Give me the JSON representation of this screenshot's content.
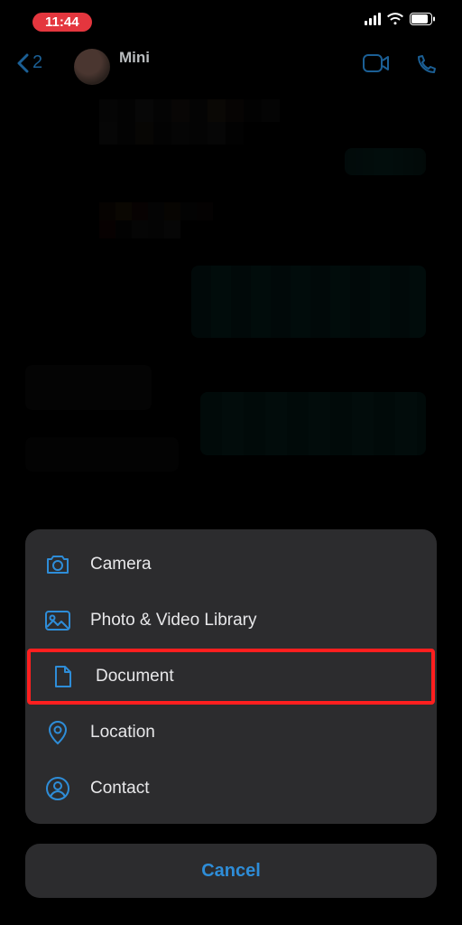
{
  "status": {
    "time": "11:44"
  },
  "nav": {
    "back_count": "2",
    "chat_name": "Mini"
  },
  "sheet": {
    "items": [
      {
        "name": "camera",
        "label": "Camera"
      },
      {
        "name": "library",
        "label": "Photo & Video Library"
      },
      {
        "name": "document",
        "label": "Document",
        "highlighted": true
      },
      {
        "name": "location",
        "label": "Location"
      },
      {
        "name": "contact",
        "label": "Contact"
      }
    ],
    "cancel_label": "Cancel"
  },
  "style": {
    "accent": "#2e8dd8",
    "sheet_bg": "#2c2c2e",
    "highlight": "#ff1f1f",
    "teal_bubble": "#0b3f3b"
  }
}
